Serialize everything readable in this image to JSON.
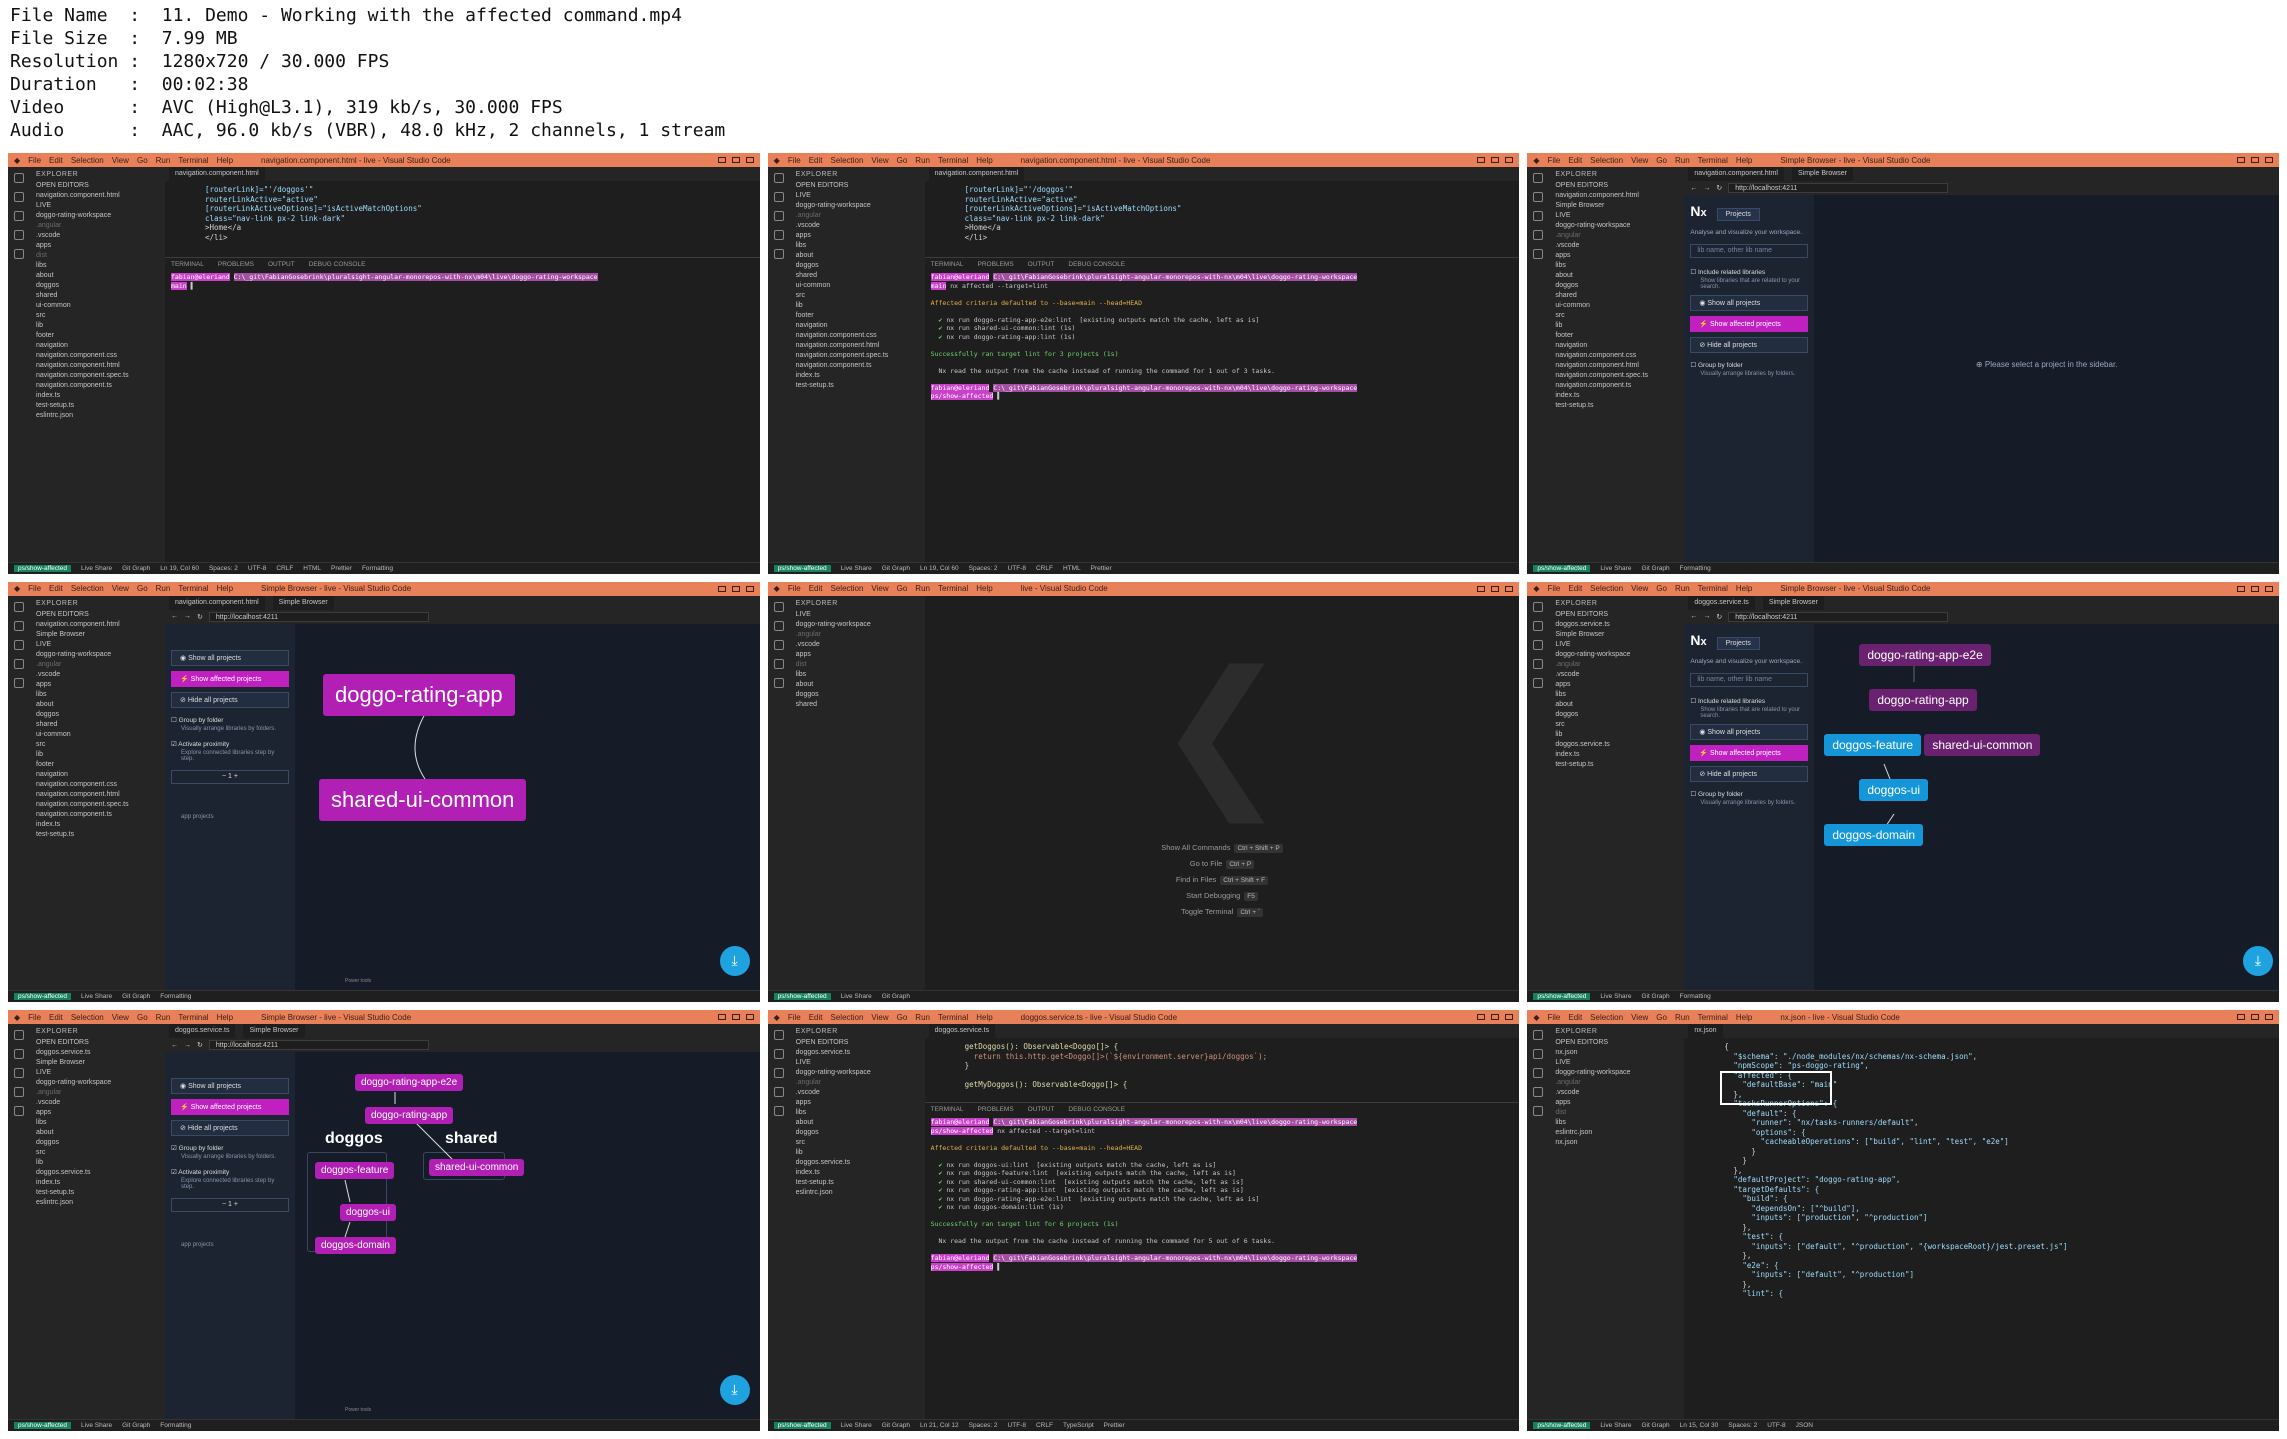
{
  "file_info": {
    "rows": [
      {
        "label": "File Name",
        "value": "11. Demo - Working with the affected command.mp4"
      },
      {
        "label": "File Size",
        "value": "7.99 MB"
      },
      {
        "label": "Resolution",
        "value": "1280x720 / 30.000 FPS"
      },
      {
        "label": "Duration",
        "value": "00:02:38"
      },
      {
        "label": "Video",
        "value": "AVC (High@L3.1), 319 kb/s, 30.000 FPS"
      },
      {
        "label": "Audio",
        "value": "AAC, 96.0 kb/s (VBR), 48.0 kHz, 2 channels, 1 stream"
      }
    ]
  },
  "menu": [
    "File",
    "Edit",
    "Selection",
    "View",
    "Go",
    "Run",
    "Terminal",
    "Help"
  ],
  "explorer_label": "EXPLORER",
  "open_editors_label": "OPEN EDITORS",
  "workspace_label": "LIVE",
  "tree": [
    "doggo-rating-workspace",
    ".angular",
    ".vscode",
    "apps",
    "dist",
    "libs",
    "about",
    "doggos",
    "shared",
    "ui-common",
    "src",
    "lib",
    "footer",
    "navigation",
    "navigation.component.css",
    "navigation.component.html",
    "navigation.component.spec.ts",
    "navigation.component.ts",
    "index.ts",
    "test-setup.ts",
    "eslintrc.json"
  ],
  "status": {
    "branch": "ps/show-affected",
    "live_share": "Live Share",
    "git_graph": "Git Graph",
    "position": "Ln 19, Col 60",
    "spaces": "Spaces: 2",
    "encoding": "UTF-8",
    "eol": "CRLF",
    "lang": "HTML",
    "prettier": "Prettier",
    "formatting": "Formatting"
  },
  "panel_tabs": [
    "TERMINAL",
    "PROBLEMS",
    "OUTPUT",
    "DEBUG CONSOLE"
  ],
  "tile1": {
    "title": "navigation.component.html - live - Visual Studio Code",
    "tab": "navigation.component.html",
    "code": [
      "[routerLink]=\"'/doggos'\"",
      "routerLinkActive=\"active\"",
      "[routerLinkActiveOptions]=\"isActiveMatchOptions\"",
      "class=\"nav-link px-2 link-dark\"",
      ">Home</a",
      "</li>"
    ],
    "prompt_user": "fabian@eleriand",
    "prompt_path": "C:\\_git\\FabianGosebrink\\pluralsight-angular-monorepos-with-nx\\m04\\live\\doggo-rating-workspace",
    "prompt_branch": "main"
  },
  "tile2": {
    "title": "navigation.component.html - live - Visual Studio Code",
    "cmd": "nx affected --target=lint",
    "affected_note": "Affected criteria defaulted to --base=main --head=HEAD",
    "results": [
      "nx run doggo-rating-app-e2e:lint  [existing outputs match the cache, left as is]",
      "nx run shared-ui-common:lint (1s)",
      "nx run doggo-rating-app:lint (1s)"
    ],
    "success": "Successfully ran target lint for 3 projects (1s)",
    "cache_note": "Nx read the output from the cache instead of running the command for 1 out of 3 tasks.",
    "prompt_branch": "ps/show-affected"
  },
  "nx": {
    "projects_label": "Projects",
    "tagline": "Analyse and visualize your workspace.",
    "filter_placeholder": "lib name, other lib name",
    "include_label": "Include related libraries",
    "include_sub": "Show libraries that are related to your search.",
    "show_all": "Show all projects",
    "show_affected": "Show affected projects",
    "hide_all": "Hide all projects",
    "group_label": "Group by folder",
    "group_sub": "Visually arrange libraries by folders.",
    "proximity_label": "Activate proximity",
    "proximity_sub": "Explore connected libraries step by step.",
    "proximity_value": "1",
    "empty_msg": "Please select a project in the sidebar.",
    "url": "http://localhost:4211",
    "browser_tab": "Simple Browser",
    "browser_title": "Simple Browser - live - Visual Studio Code",
    "powered": "Power tools",
    "app_projects": "app projects"
  },
  "graph4": {
    "top": "doggo-rating-app",
    "bottom": "shared-ui-common"
  },
  "tile5": {
    "title": "live - Visual Studio Code",
    "shortcuts": [
      {
        "label": "Show All Commands",
        "keys": "Ctrl + Shift + P"
      },
      {
        "label": "Go to File",
        "keys": "Ctrl + P"
      },
      {
        "label": "Find in Files",
        "keys": "Ctrl + Shift + F"
      },
      {
        "label": "Start Debugging",
        "keys": "F5"
      },
      {
        "label": "Toggle Terminal",
        "keys": "Ctrl + `"
      }
    ]
  },
  "graph6": {
    "e2e": "doggo-rating-app-e2e",
    "app": "doggo-rating-app",
    "feature": "doggos-feature",
    "common": "shared-ui-common",
    "ui": "doggos-ui",
    "domain": "doggos-domain"
  },
  "graph7": {
    "e2e": "doggo-rating-app-e2e",
    "app": "doggo-rating-app",
    "group_doggos": "doggos",
    "group_shared": "shared",
    "feature": "doggos-feature",
    "ui": "doggos-ui",
    "domain": "doggos-domain",
    "common": "shared-ui-common"
  },
  "tile8": {
    "title": "doggos.service.ts - live - Visual Studio Code",
    "tab": "doggos.service.ts",
    "code": [
      "getDoggos(): Observable<Doggo[]> {",
      "  return this.http.get<Doggo[]>(`${environment.server}api/doggos`);",
      "}",
      "",
      "getMyDoggos(): Observable<Doggo[]> {"
    ],
    "cmd": "nx affected --target=lint",
    "affected_note": "Affected criteria defaulted to --base=main --head=HEAD",
    "results": [
      "nx run doggos-ui:lint  [existing outputs match the cache, left as is]",
      "nx run doggos-feature:lint  [existing outputs match the cache, left as is]",
      "nx run shared-ui-common:lint  [existing outputs match the cache, left as is]",
      "nx run doggo-rating-app:lint  [existing outputs match the cache, left as is]",
      "nx run doggo-rating-app-e2e:lint  [existing outputs match the cache, left as is]",
      "nx run doggos-domain:lint (1s)"
    ],
    "success": "Successfully ran target lint for 6 projects (1s)",
    "cache_note": "Nx read the output from the cache instead of running the command for 5 out of 6 tasks.",
    "position": "Ln 21, Col 12",
    "lang": "TypeScript"
  },
  "tile9": {
    "title": "nx.json - live - Visual Studio Code",
    "tab": "nx.json",
    "code": [
      "{",
      "  \"$schema\": \"./node_modules/nx/schemas/nx-schema.json\",",
      "  \"npmScope\": \"ps-doggo-rating\",",
      "  \"affected\": {",
      "    \"defaultBase\": \"main\"",
      "  },",
      "  \"tasksRunnerOptions\": {",
      "    \"default\": {",
      "      \"runner\": \"nx/tasks-runners/default\",",
      "      \"options\": {",
      "        \"cacheableOperations\": [\"build\", \"lint\", \"test\", \"e2e\"]",
      "      }",
      "    }",
      "  },",
      "  \"defaultProject\": \"doggo-rating-app\",",
      "  \"targetDefaults\": {",
      "    \"build\": {",
      "      \"dependsOn\": [\"^build\"],",
      "      \"inputs\": [\"production\", \"^production\"]",
      "    },",
      "    \"test\": {",
      "      \"inputs\": [\"default\", \"^production\", \"{workspaceRoot}/jest.preset.js\"]",
      "    },",
      "    \"e2e\": {",
      "      \"inputs\": [\"default\", \"^production\"]",
      "    },",
      "    \"lint\": {"
    ],
    "position": "Ln 15, Col 30",
    "lang": "JSON"
  }
}
